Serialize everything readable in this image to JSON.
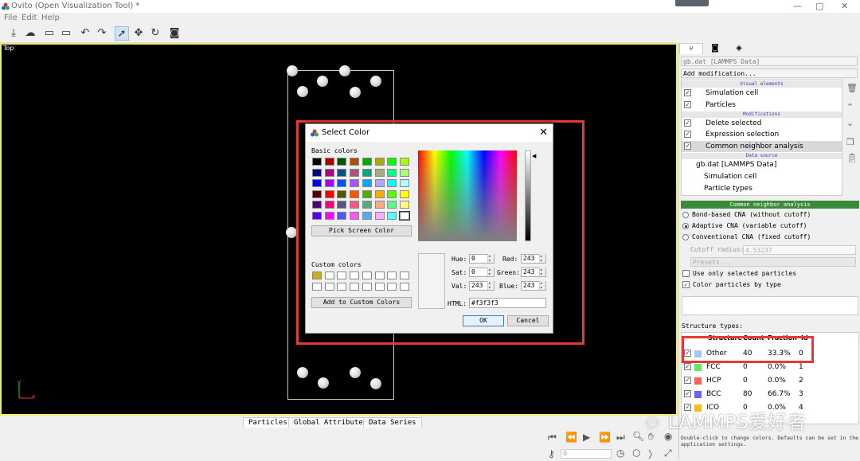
{
  "window": {
    "title": "Ovito (Open Visualization Tool) *",
    "controls": [
      "—",
      "▢",
      "✕"
    ]
  },
  "menu": [
    "File",
    "Edit",
    "Help"
  ],
  "viewport": {
    "label": "Top",
    "axis_x": "x",
    "axis_y": "y"
  },
  "bottom_tabs": [
    "Particles",
    "Global Attributes",
    "Data Series"
  ],
  "animation": {
    "frame": "0"
  },
  "panel": {
    "pipeline_select": "gb.dat [LAMMPS Data]",
    "add_modification": "Add modification...",
    "sections": {
      "visual": "Visual elements",
      "modifications": "Modifications",
      "source": "Data source"
    },
    "visual_items": [
      "Simulation cell",
      "Particles"
    ],
    "modifier_items": [
      "Delete selected",
      "Expression selection",
      "Common neighbor analysis"
    ],
    "source_items": [
      "gb.dat [LAMMPS Data]",
      "Simulation cell",
      "Particle types"
    ],
    "cna_header": "Common neighbor analysis",
    "modes": [
      "Bond-based CNA (without cutoff)",
      "Adaptive CNA (variable cutoff)",
      "Conventional CNA (fixed cutoff)"
    ],
    "cutoff_label": "Cutoff radius:",
    "cutoff_value": "4.53237",
    "presets": "Presets...",
    "use_selected": "Use only selected particles",
    "color_by_type": "Color particles by type",
    "structure_types_label": "Structure types:",
    "table_headers": [
      "Structure",
      "Count",
      "Fraction",
      "Id"
    ],
    "rows": [
      {
        "name": "Other",
        "count": "40",
        "fraction": "33.3%",
        "id": "0",
        "color": "#a8c8e8"
      },
      {
        "name": "FCC",
        "count": "0",
        "fraction": "0.0%",
        "id": "1",
        "color": "#66e666"
      },
      {
        "name": "HCP",
        "count": "0",
        "fraction": "0.0%",
        "id": "2",
        "color": "#f06666"
      },
      {
        "name": "BCC",
        "count": "80",
        "fraction": "66.7%",
        "id": "3",
        "color": "#6666f0"
      },
      {
        "name": "ICO",
        "count": "0",
        "fraction": "0.0%",
        "id": "4",
        "color": "#f0c020"
      }
    ],
    "status_note": "Double-click to change colors. Defaults can be set in the application settings."
  },
  "dialog": {
    "title": "Select Color",
    "basic_colors_label": "Basic colors",
    "custom_colors_label": "Custom colors",
    "pick_screen": "Pick Screen Color",
    "add_custom": "Add to Custom Colors",
    "hue_label": "Hue:",
    "hue": "0",
    "sat_label": "Sat:",
    "sat": "0",
    "val_label": "Val:",
    "val": "243",
    "red_label": "Red:",
    "red": "243",
    "green_label": "Green:",
    "green": "243",
    "blue_label": "Blue:",
    "blue": "243",
    "html_label": "HTML:",
    "html": "#f3f3f3",
    "ok": "OK",
    "cancel": "Cancel",
    "basic_colors": [
      "#000000",
      "#aa0000",
      "#005500",
      "#aa5500",
      "#00aa00",
      "#aaaa00",
      "#00ff00",
      "#aaff00",
      "#000080",
      "#aa007f",
      "#00557f",
      "#aa557f",
      "#00aa7f",
      "#aaaa7f",
      "#00ff7f",
      "#aaff7f",
      "#0000ff",
      "#aa00ff",
      "#0055ff",
      "#aa55ff",
      "#00aaff",
      "#aaaaff",
      "#00ffff",
      "#aaffff",
      "#550000",
      "#ff0000",
      "#555500",
      "#ff5500",
      "#55aa00",
      "#ffaa00",
      "#55ff00",
      "#ffff00",
      "#55007f",
      "#ff007f",
      "#55557f",
      "#ff557f",
      "#55aa7f",
      "#ffaa7f",
      "#55ff7f",
      "#ffff7f",
      "#5500ff",
      "#ff00ff",
      "#5555ff",
      "#ff55ff",
      "#55aaff",
      "#ffaaff",
      "#55ffff",
      "#ffffff"
    ],
    "custom_first": "#c8b020"
  },
  "watermark": "LAMMPS爱好者"
}
